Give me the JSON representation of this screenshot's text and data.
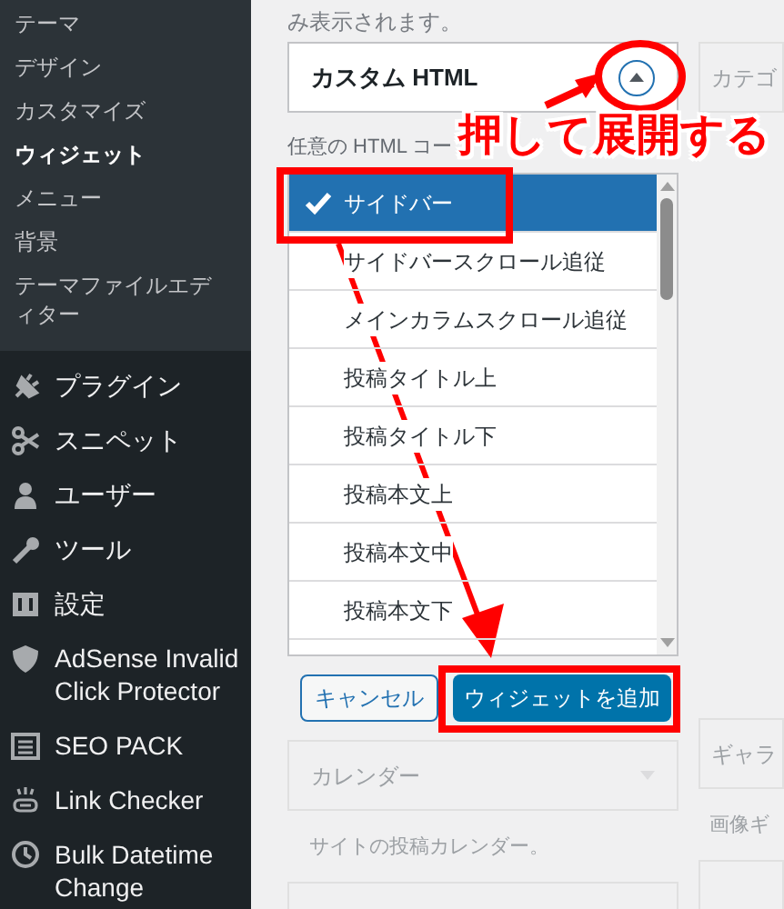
{
  "admin_menu": {
    "submenu": [
      {
        "label": "テーマ",
        "selected": false
      },
      {
        "label": "デザイン",
        "selected": false
      },
      {
        "label": "カスタマイズ",
        "selected": false
      },
      {
        "label": "ウィジェット",
        "selected": true
      },
      {
        "label": "メニュー",
        "selected": false
      },
      {
        "label": "背景",
        "selected": false
      },
      {
        "label": "テーマファイルエディター",
        "selected": false
      }
    ],
    "items": [
      {
        "label": "プラグイン",
        "kind": "plugin"
      },
      {
        "label": "スニペット",
        "kind": "scissors"
      },
      {
        "label": "ユーザー",
        "kind": "user"
      },
      {
        "label": "ツール",
        "kind": "wrench"
      },
      {
        "label": "設定",
        "kind": "sliders"
      },
      {
        "label": "AdSense Invalid Click Protector",
        "kind": "shield"
      },
      {
        "label": "SEO PACK",
        "kind": "list"
      },
      {
        "label": "Link Checker",
        "kind": "link"
      },
      {
        "label": "Bulk Datetime Change",
        "kind": "clock"
      }
    ]
  },
  "top_note": "み表示されます。",
  "widget": {
    "title": "カスタム HTML",
    "expanded": true,
    "description": "任意の HTML コー"
  },
  "side_widget": {
    "title": "カテゴ"
  },
  "area_list": {
    "items": [
      {
        "label": "サイドバー",
        "selected": true
      },
      {
        "label": "サイドバースクロール追従",
        "selected": false
      },
      {
        "label": "メインカラムスクロール追従",
        "selected": false
      },
      {
        "label": "投稿タイトル上",
        "selected": false
      },
      {
        "label": "投稿タイトル下",
        "selected": false
      },
      {
        "label": "投稿本文上",
        "selected": false
      },
      {
        "label": "投稿本文中",
        "selected": false
      },
      {
        "label": "投稿本文下",
        "selected": false
      }
    ]
  },
  "buttons": {
    "cancel": "キャンセル",
    "add": "ウィジェットを追加"
  },
  "faded_widgets": [
    {
      "title": "カレンダー",
      "description": "サイトの投稿カレンダー。"
    }
  ],
  "faded_side_widgets": [
    {
      "title": "ギャラ",
      "description": "画像ギ"
    }
  ],
  "annotation": {
    "text": "押して展開する"
  }
}
